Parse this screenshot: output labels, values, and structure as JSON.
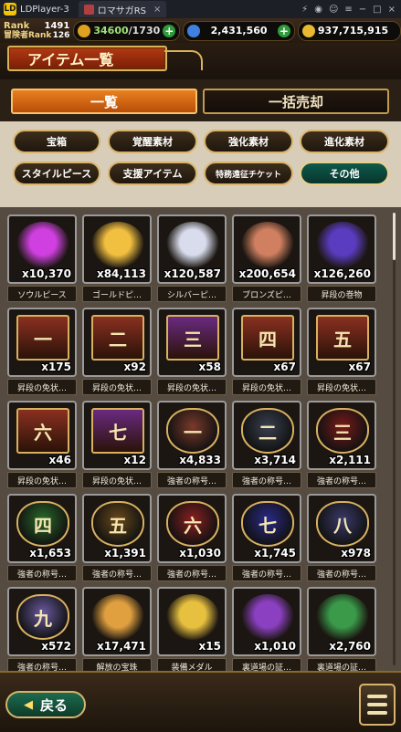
{
  "emulator": {
    "app_name": "LDPlayer-3",
    "tab_label": "ロマサガRS",
    "logo_text": "LD"
  },
  "status": {
    "rank_label": "Rank",
    "rank_value": "1491",
    "adv_rank_label": "冒険者Rank",
    "adv_rank_value": "126",
    "stamina_current": "34600",
    "stamina_max": "/1730",
    "gems": "2,431,560",
    "gold": "937,715,915"
  },
  "header": {
    "title": "アイテム一覧"
  },
  "tabs": [
    {
      "label": "一覧"
    },
    {
      "label": "一括売却"
    }
  ],
  "filters": [
    {
      "label": "宝箱"
    },
    {
      "label": "覚醒素材"
    },
    {
      "label": "強化素材"
    },
    {
      "label": "進化素材"
    },
    {
      "label": "スタイルピース"
    },
    {
      "label": "支援アイテム"
    },
    {
      "label": "特務遠征チケット"
    },
    {
      "label": "その他"
    }
  ],
  "items": [
    {
      "name": "ソウルピース",
      "qty": "x10,370",
      "icon": "soul-piece",
      "color": "#d040e0"
    },
    {
      "name": "ゴールドピ…",
      "qty": "x84,113",
      "icon": "gold-piece",
      "color": "#f2c040"
    },
    {
      "name": "シルバーピ…",
      "qty": "x120,587",
      "icon": "silver-piece",
      "color": "#d8dcec"
    },
    {
      "name": "ブロンズピ…",
      "qty": "x200,654",
      "icon": "bronze-piece",
      "color": "#d08060"
    },
    {
      "name": "昇段の巻物",
      "qty": "x126,260",
      "icon": "scroll",
      "color": "#5a3cc0"
    },
    {
      "name": "昇段の免状…",
      "qty": "x175",
      "icon": "license-1",
      "color": "#8a3020",
      "glyph": "一"
    },
    {
      "name": "昇段の免状…",
      "qty": "x92",
      "icon": "license-2",
      "color": "#8a3020",
      "glyph": "二"
    },
    {
      "name": "昇段の免状…",
      "qty": "x58",
      "icon": "license-3",
      "color": "#6a2a80",
      "glyph": "三"
    },
    {
      "name": "昇段の免状…",
      "qty": "x67",
      "icon": "license-4",
      "color": "#8a3020",
      "glyph": "四"
    },
    {
      "name": "昇段の免状…",
      "qty": "x67",
      "icon": "license-5",
      "color": "#8a3020",
      "glyph": "五"
    },
    {
      "name": "昇段の免状…",
      "qty": "x46",
      "icon": "license-6",
      "color": "#8a3020",
      "glyph": "六"
    },
    {
      "name": "昇段の免状…",
      "qty": "x12",
      "icon": "license-7",
      "color": "#6a2a80",
      "glyph": "七"
    },
    {
      "name": "強者の称号…",
      "qty": "x4,833",
      "icon": "badge-1",
      "color": "#7a3a2a",
      "glyph": "一"
    },
    {
      "name": "強者の称号…",
      "qty": "x3,714",
      "icon": "badge-2",
      "color": "#3a4050",
      "glyph": "二"
    },
    {
      "name": "強者の称号…",
      "qty": "x2,111",
      "icon": "badge-3",
      "color": "#7a1a1a",
      "glyph": "三"
    },
    {
      "name": "強者の称号…",
      "qty": "x1,653",
      "icon": "badge-4",
      "color": "#2a6a2a",
      "glyph": "四"
    },
    {
      "name": "強者の称号…",
      "qty": "x1,391",
      "icon": "badge-5",
      "color": "#6a4a1a",
      "glyph": "五"
    },
    {
      "name": "強者の称号…",
      "qty": "x1,030",
      "icon": "badge-6",
      "color": "#8a2020",
      "glyph": "六"
    },
    {
      "name": "強者の称号…",
      "qty": "x1,745",
      "icon": "badge-7",
      "color": "#2a2a8a",
      "glyph": "七"
    },
    {
      "name": "強者の称号…",
      "qty": "x978",
      "icon": "badge-8",
      "color": "#3a3a6a",
      "glyph": "八"
    },
    {
      "name": "強者の称号…",
      "qty": "x572",
      "icon": "badge-9",
      "color": "#6a5aa0",
      "glyph": "九"
    },
    {
      "name": "解放の宝珠",
      "qty": "x17,471",
      "icon": "orb",
      "color": "#e0a040"
    },
    {
      "name": "装備メダル",
      "qty": "x15",
      "icon": "medal",
      "color": "#e8c040"
    },
    {
      "name": "裏道場の証…",
      "qty": "x1,010",
      "icon": "proof-purple",
      "color": "#8a40c0"
    },
    {
      "name": "裏道場の証…",
      "qty": "x2,760",
      "icon": "proof-green",
      "color": "#3a9a4a"
    }
  ],
  "footer": {
    "back_label": "戻る",
    "back_arrow": "◀"
  }
}
